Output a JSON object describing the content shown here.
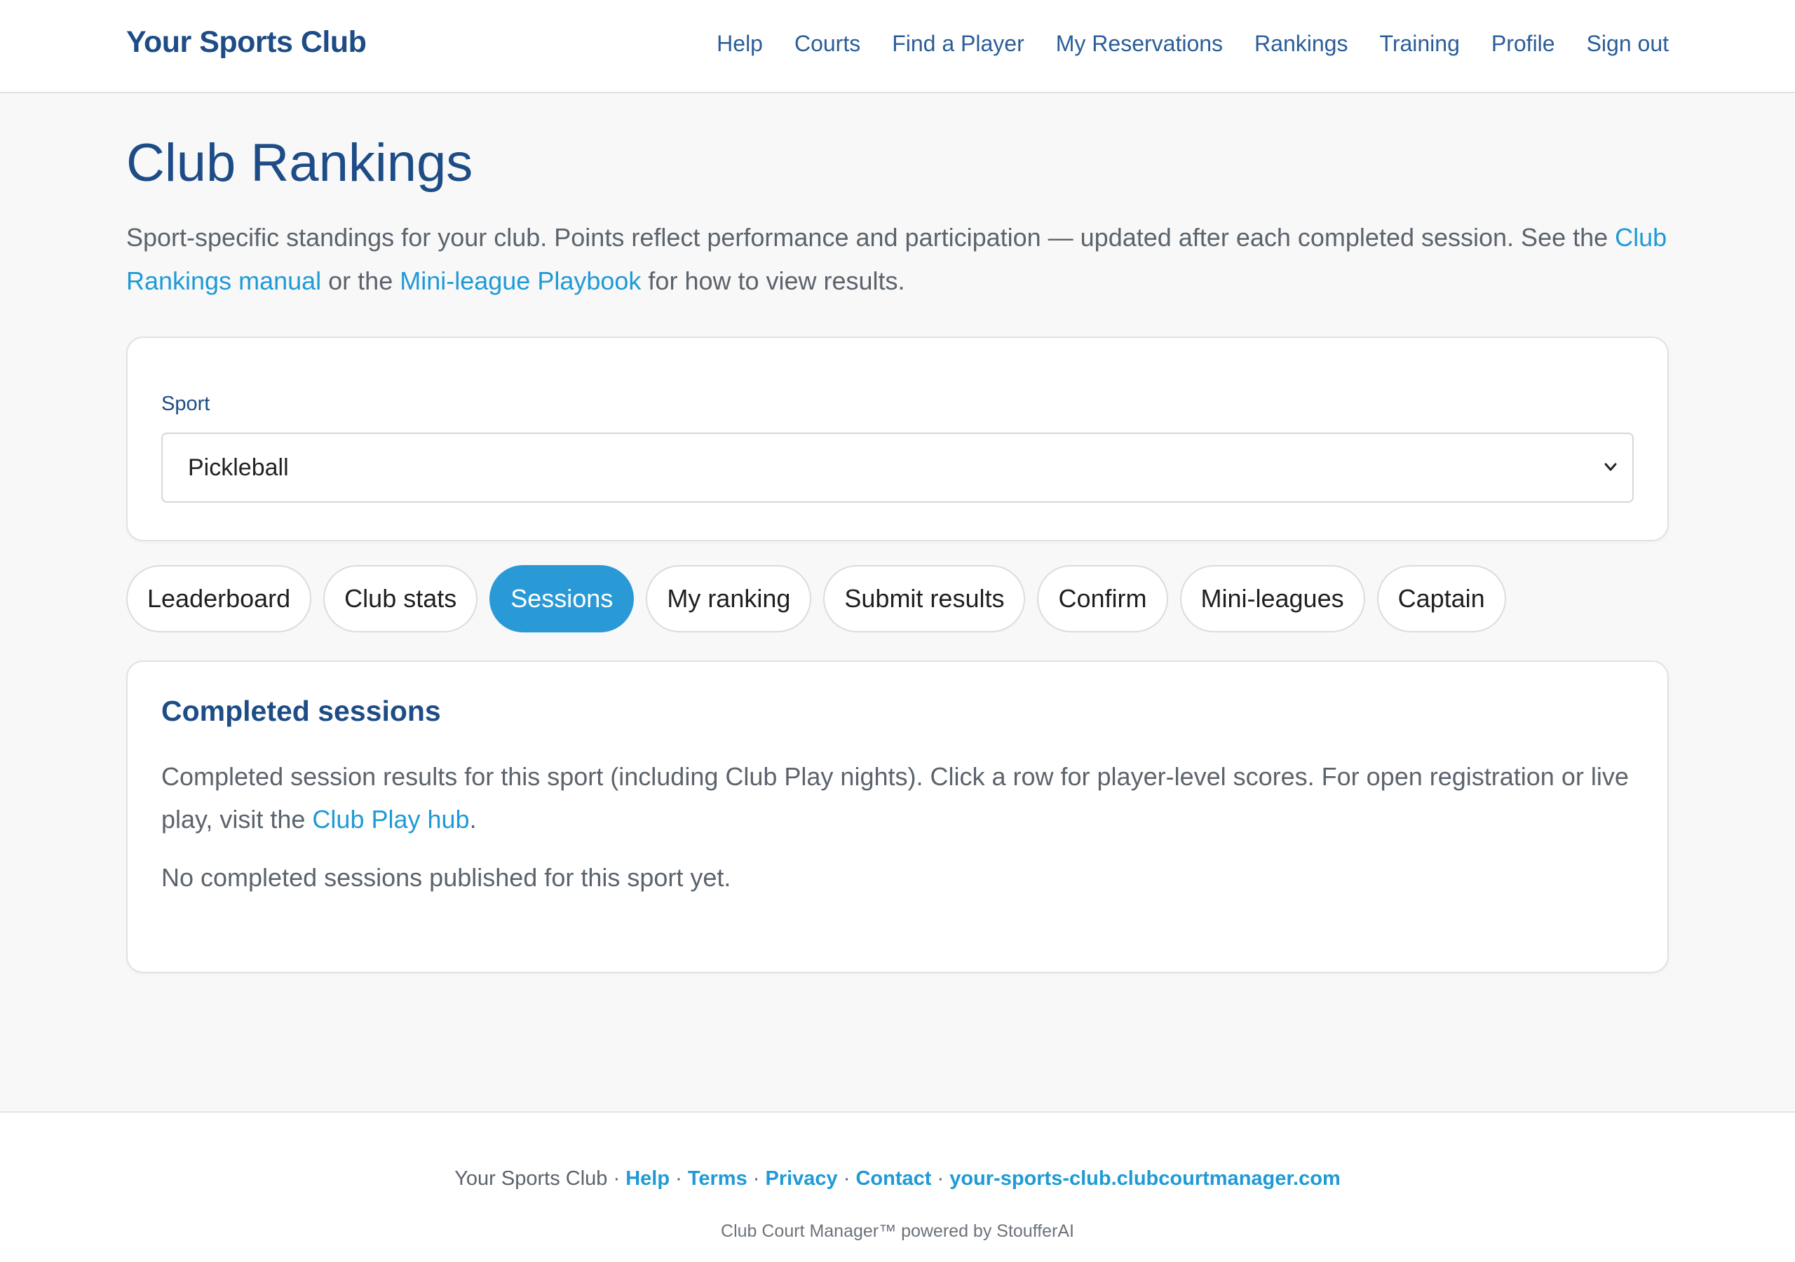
{
  "nav": {
    "brand": "Your Sports Club",
    "links": [
      "Help",
      "Courts",
      "Find a Player",
      "My Reservations",
      "Rankings",
      "Training",
      "Profile",
      "Sign out"
    ]
  },
  "page": {
    "title": "Club Rankings",
    "intro_before": "Sport-specific standings for your club. Points reflect performance and participation — updated after each completed session. See the ",
    "intro_link1": "Club Rankings manual",
    "intro_middle": " or the ",
    "intro_link2": "Mini-league Playbook",
    "intro_after": " for how to view results."
  },
  "sport_filter": {
    "label": "Sport",
    "selected": "Pickleball"
  },
  "tabs": [
    "Leaderboard",
    "Club stats",
    "Sessions",
    "My ranking",
    "Submit results",
    "Confirm",
    "Mini-leagues",
    "Captain"
  ],
  "active_tab": "Sessions",
  "sessions": {
    "title": "Completed sessions",
    "desc_before": "Completed session results for this sport (including Club Play nights). Click a row for player-level scores. For open registration or live play, visit the ",
    "desc_link": "Club Play hub",
    "desc_after": ".",
    "empty_message": "No completed sessions published for this sport yet."
  },
  "footer": {
    "site_name": "Your Sports Club",
    "separator": " · ",
    "links": [
      "Help",
      "Terms",
      "Privacy",
      "Contact",
      "your-sports-club.clubcourtmanager.com"
    ],
    "note": "Club Court Manager™ powered by StoufferAI"
  },
  "colors": {
    "brand": "#1d4c86",
    "link": "#1f9ad6",
    "active_tab": "#2a9ad6",
    "background": "#f8f8f8"
  }
}
